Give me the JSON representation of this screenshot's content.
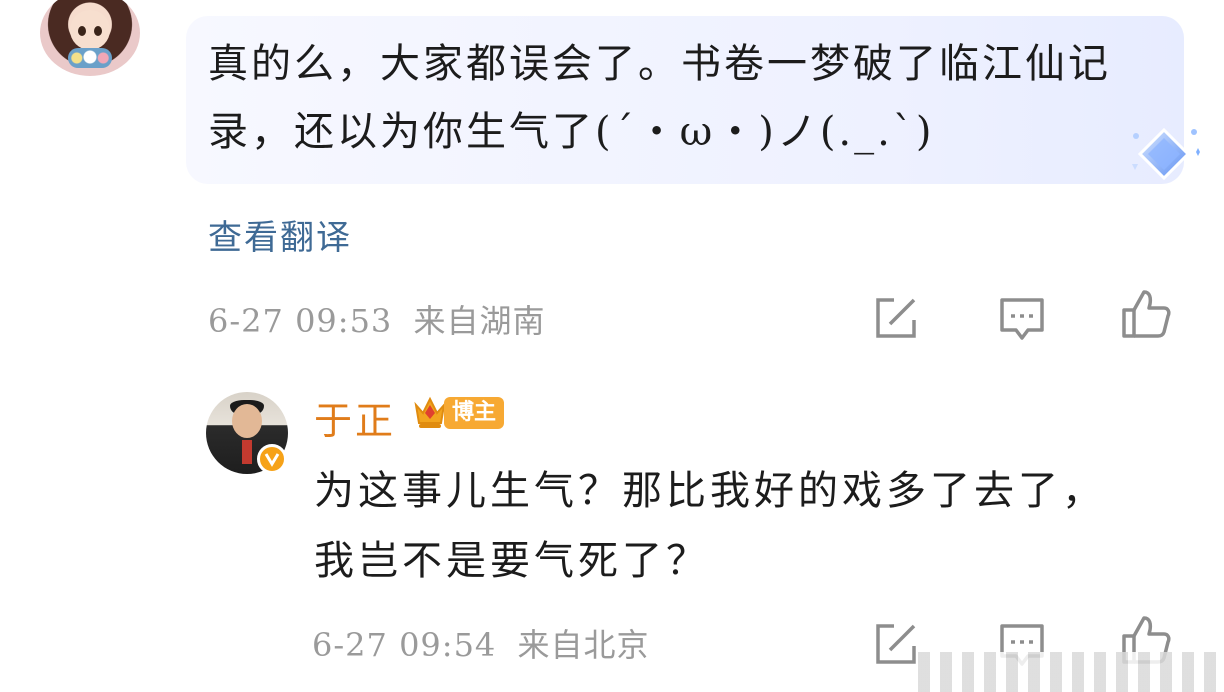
{
  "comment": {
    "text": "真的么，大家都误会了。书卷一梦破了临江仙记录，还以为你生气了(´・ω・)ノ(._.`)",
    "translate_label": "查看翻译",
    "time": "6-27 09:53",
    "location": "来自湖南",
    "avatar_icon": "girl-cartoon-avatar",
    "badge_icon": "blue-diamond-icon"
  },
  "reply": {
    "username": "于正",
    "badge_label": "博主",
    "text": "为这事儿生气？那比我好的戏多了去了，我岂不是要气死了？",
    "time": "6-27 09:54",
    "location": "来自北京",
    "verified_icon": "verified-v-icon"
  },
  "actions": [
    "share-edit-icon",
    "comment-icon",
    "like-icon"
  ],
  "colors": {
    "username": "#e07c1a",
    "link": "#3f6a95",
    "meta": "#9a9a9a",
    "bubble": "#eef1ff",
    "badge": "#f7a933",
    "verified": "#f6a218"
  }
}
